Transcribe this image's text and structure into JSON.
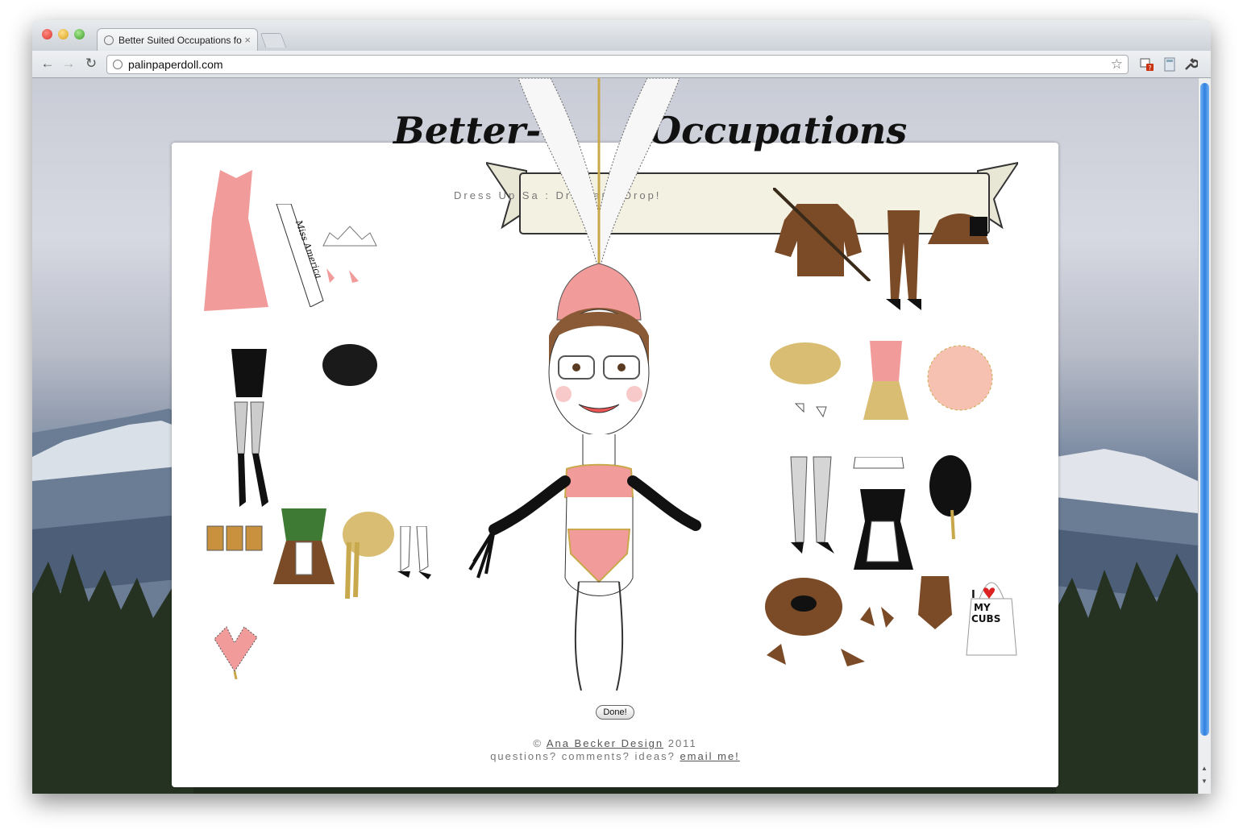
{
  "browser": {
    "tab_title": "Better Suited Occupations fo",
    "tab_close": "×",
    "url": "palinpaperdoll.com",
    "back": "←",
    "forward": "→",
    "reload": "↻",
    "bookmark_star": "☆"
  },
  "page": {
    "banner_left": "Better-",
    "banner_right": "Occupations",
    "subtitle": "Dress Up Sa        : Drag and Drop!",
    "done_label": "Done!",
    "footer_copyright": "©",
    "footer_company": "Ana Becker Design",
    "footer_year": "2011",
    "footer_questions": "questions? comments? ideas?",
    "footer_email": "email me!",
    "sash_text": "Miss America",
    "apron_text_i": "I",
    "apron_text_my": "MY",
    "apron_text_cubs": "CUBS"
  },
  "colors": {
    "accent_pink": "#f29b9b",
    "brown": "#7b4a26",
    "gold": "#c8a84a",
    "scrollbar": "#2f80e0"
  }
}
